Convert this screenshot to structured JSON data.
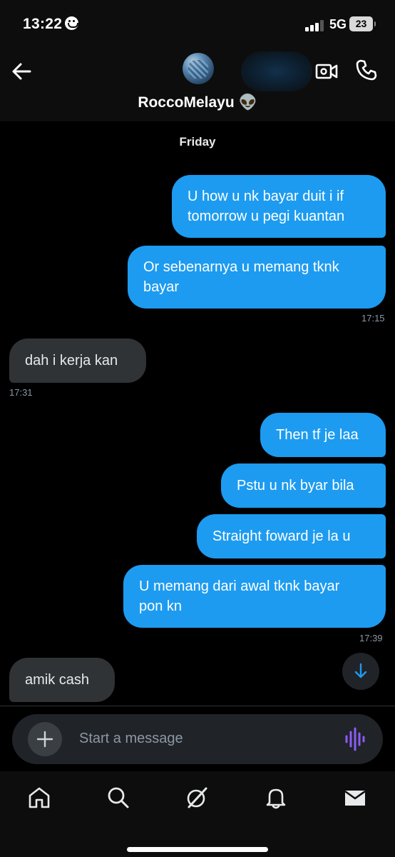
{
  "status_bar": {
    "time": "13:22",
    "network": "5G",
    "battery": "23"
  },
  "header": {
    "contact_name": "RoccoMelayu",
    "contact_emoji": "👽"
  },
  "conversation": {
    "date_label": "Friday",
    "messages": [
      {
        "direction": "outgoing",
        "lines": [
          "U how u nk bayar duit i if",
          "tomorrow u pegi kuantan"
        ]
      },
      {
        "direction": "outgoing",
        "lines": [
          "Or sebenarnya u memang tknk",
          "bayar"
        ],
        "time": "17:15"
      },
      {
        "direction": "incoming",
        "lines": [
          "dah i kerja kan"
        ],
        "time": "17:31"
      },
      {
        "direction": "outgoing",
        "lines": [
          "Then tf je laa"
        ]
      },
      {
        "direction": "outgoing",
        "lines": [
          "Pstu u nk byar bila"
        ]
      },
      {
        "direction": "outgoing",
        "lines": [
          "Straight foward je la u"
        ]
      },
      {
        "direction": "outgoing",
        "lines": [
          "U memang dari awal tknk bayar",
          "pon kn"
        ],
        "time": "17:39"
      },
      {
        "direction": "incoming",
        "lines": [
          "amik cash"
        ]
      }
    ]
  },
  "composer": {
    "placeholder": "Start a message"
  },
  "bottom_nav": [
    "home-icon",
    "search-icon",
    "grok-icon",
    "notifications-icon",
    "messages-icon"
  ],
  "colors": {
    "outgoing_bubble": "#1d9bf0",
    "incoming_bubble": "#2f3336",
    "voice_accent": "#8b5cf6"
  }
}
